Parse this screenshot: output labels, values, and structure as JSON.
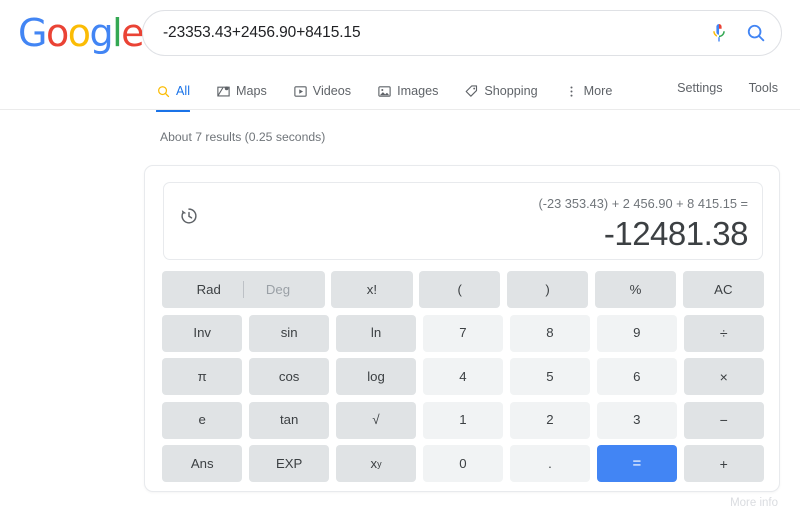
{
  "logo": {
    "letters": [
      "G",
      "o",
      "o",
      "g",
      "l",
      "e"
    ]
  },
  "search": {
    "query": "-23353.43+2456.90+8415.15",
    "mic_icon": "microphone-icon",
    "search_icon": "search-icon"
  },
  "nav": {
    "tabs": [
      {
        "label": "All",
        "icon": "search-icon",
        "active": true
      },
      {
        "label": "Maps",
        "icon": "map-icon",
        "active": false
      },
      {
        "label": "Videos",
        "icon": "video-icon",
        "active": false
      },
      {
        "label": "Images",
        "icon": "image-icon",
        "active": false
      },
      {
        "label": "Shopping",
        "icon": "tag-icon",
        "active": false
      },
      {
        "label": "More",
        "icon": "more-vertical-icon",
        "active": false
      }
    ],
    "links": [
      {
        "label": "Settings"
      },
      {
        "label": "Tools"
      }
    ]
  },
  "results": {
    "stats": "About 7 results (0.25 seconds)"
  },
  "calculator": {
    "history_icon": "history-icon",
    "expression": "(-23 353.43) + 2 456.90 + 8 415.15 =",
    "result": "-12481.38",
    "mode": {
      "active": "Rad",
      "inactive": "Deg"
    },
    "rows": [
      [
        {
          "label": "x!",
          "type": "func"
        },
        {
          "label": "(",
          "type": "func"
        },
        {
          "label": ")",
          "type": "func"
        },
        {
          "label": "%",
          "type": "func"
        },
        {
          "label": "AC",
          "type": "func"
        }
      ],
      [
        {
          "label": "Inv",
          "type": "func"
        },
        {
          "label": "sin",
          "type": "func"
        },
        {
          "label": "ln",
          "type": "func"
        },
        {
          "label": "7",
          "type": "digit"
        },
        {
          "label": "8",
          "type": "digit"
        },
        {
          "label": "9",
          "type": "digit"
        },
        {
          "label": "÷",
          "type": "op"
        }
      ],
      [
        {
          "label": "π",
          "type": "func"
        },
        {
          "label": "cos",
          "type": "func"
        },
        {
          "label": "log",
          "type": "func"
        },
        {
          "label": "4",
          "type": "digit"
        },
        {
          "label": "5",
          "type": "digit"
        },
        {
          "label": "6",
          "type": "digit"
        },
        {
          "label": "×",
          "type": "op"
        }
      ],
      [
        {
          "label": "e",
          "type": "func"
        },
        {
          "label": "tan",
          "type": "func"
        },
        {
          "label": "√",
          "type": "func"
        },
        {
          "label": "1",
          "type": "digit"
        },
        {
          "label": "2",
          "type": "digit"
        },
        {
          "label": "3",
          "type": "digit"
        },
        {
          "label": "−",
          "type": "op"
        }
      ],
      [
        {
          "label": "Ans",
          "type": "func"
        },
        {
          "label": "EXP",
          "type": "func"
        },
        {
          "label": "xy",
          "type": "func",
          "power": true
        },
        {
          "label": "0",
          "type": "digit"
        },
        {
          "label": ".",
          "type": "digit"
        },
        {
          "label": "=",
          "type": "equals"
        },
        {
          "label": "+",
          "type": "op"
        }
      ]
    ]
  },
  "footer": {
    "more_info": "More info"
  },
  "colors": {
    "google_blue": "#4285f4",
    "google_red": "#ea4335",
    "google_yellow": "#fbbc05",
    "google_green": "#34a853",
    "active_tab": "#1a73e8",
    "key_func": "#e0e3e5",
    "key_digit": "#f1f3f4"
  }
}
